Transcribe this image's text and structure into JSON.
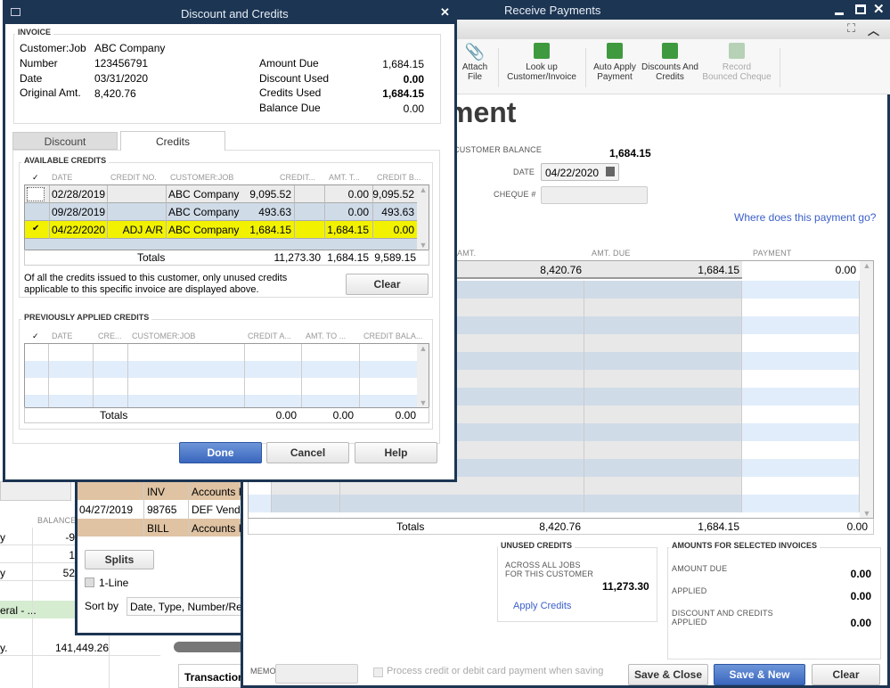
{
  "background": {
    "left_window": {
      "balance_header": "BALANCE",
      "rows": [
        {
          "a": "y",
          "b": "-9"
        },
        {
          "a": "",
          "b": "1"
        },
        {
          "a": "y",
          "b": "52"
        },
        {
          "a": "eral - ...",
          "b": ""
        },
        {
          "a": "y.",
          "b": "141,449.26"
        }
      ],
      "tab_transactions": "Transactions"
    },
    "middle_window": {
      "rows": [
        {
          "date": "",
          "num": "INV",
          "acct": "Accounts F"
        },
        {
          "date": "04/27/2019",
          "num": "98765",
          "acct": "DEF Vendo"
        },
        {
          "date": "",
          "num": "BILL",
          "acct": "Accounts F"
        }
      ],
      "splits_label": "Splits",
      "one_line_label": "1-Line",
      "sort_by_label": "Sort by",
      "sort_by_value": "Date, Type, Number/Ref"
    }
  },
  "receive_payments": {
    "title": "Receive Payments",
    "toolbar": [
      {
        "icon": "paperclip-icon",
        "label1": "Attach",
        "label2": "File",
        "enabled": true
      },
      {
        "icon": "lookup-customer-icon",
        "label1": "Look up",
        "label2": "Customer/Invoice",
        "enabled": true
      },
      {
        "icon": "auto-apply-icon",
        "label1": "Auto Apply",
        "label2": "Payment",
        "enabled": true
      },
      {
        "icon": "discounts-credits-icon",
        "label1": "Discounts And",
        "label2": "Credits",
        "enabled": true
      },
      {
        "icon": "bounced-cheque-icon",
        "label1": "Record",
        "label2": "Bounced Cheque",
        "enabled": false
      }
    ],
    "heading_partial": "ment",
    "customer_balance_label": "CUSTOMER BALANCE",
    "customer_balance": "1,684.15",
    "date_label": "DATE",
    "date_value": "04/22/2020",
    "cheque_label": "CHEQUE #",
    "cheque_value": "",
    "where_link": "Where does this payment go?",
    "grid": {
      "headers": [
        "AMT.",
        "AMT. DUE",
        "PAYMENT"
      ],
      "row": {
        "amt": "8,420.76",
        "amt_due": "1,684.15",
        "payment": "0.00"
      },
      "totals_label": "Totals",
      "totals": {
        "amt": "8,420.76",
        "amt_due": "1,684.15",
        "payment": "0.00"
      }
    },
    "unused_credits": {
      "title": "UNUSED CREDITS",
      "line1": "ACROSS ALL JOBS",
      "line2": "FOR THIS CUSTOMER",
      "amount": "11,273.30",
      "apply_link": "Apply Credits"
    },
    "amounts": {
      "title": "AMOUNTS FOR SELECTED INVOICES",
      "amount_due_label": "AMOUNT DUE",
      "amount_due": "0.00",
      "applied_label": "APPLIED",
      "applied": "0.00",
      "disc_label1": "DISCOUNT AND CREDITS",
      "disc_label2": "APPLIED",
      "disc": "0.00"
    },
    "memo_label": "MEMO",
    "process_label": "Process credit or debit card payment when saving",
    "save_close": "Save & Close",
    "save_new": "Save & New",
    "clear": "Clear"
  },
  "dialog": {
    "title": "Discount and Credits",
    "invoice": {
      "title": "INVOICE",
      "customer_label": "Customer:Job",
      "customer": "ABC Company",
      "number_label": "Number",
      "number": "123456791",
      "date_label": "Date",
      "date": "03/31/2020",
      "orig_label": "Original Amt.",
      "orig": "8,420.76",
      "amount_due_label": "Amount Due",
      "amount_due": "1,684.15",
      "discount_used_label": "Discount Used",
      "discount_used": "0.00",
      "credits_used_label": "Credits Used",
      "credits_used": "1,684.15",
      "balance_due_label": "Balance Due",
      "balance_due": "0.00"
    },
    "tabs": [
      {
        "label": "Discount",
        "active": false
      },
      {
        "label": "Credits",
        "active": true
      }
    ],
    "available": {
      "title": "AVAILABLE CREDITS",
      "headers": [
        "✓",
        "DATE",
        "CREDIT NO.",
        "CUSTOMER:JOB",
        "CREDIT...",
        "AMT. T...",
        "CREDIT B..."
      ],
      "rows": [
        {
          "checked": false,
          "date": "02/28/2019",
          "credit_no": "",
          "customer": "ABC Company",
          "credit": "9,095.52",
          "amt": "0.00",
          "balance": "9,095.52"
        },
        {
          "checked": false,
          "date": "09/28/2019",
          "credit_no": "",
          "customer": "ABC Company",
          "credit": "493.63",
          "amt": "0.00",
          "balance": "493.63"
        },
        {
          "checked": true,
          "date": "04/22/2020",
          "credit_no": "ADJ A/R",
          "customer": "ABC Company",
          "credit": "1,684.15",
          "amt": "1,684.15",
          "balance": "0.00"
        }
      ],
      "totals_label": "Totals",
      "totals": {
        "credit": "11,273.30",
        "amt": "1,684.15",
        "balance": "9,589.15"
      },
      "note1": "Of all the credits issued to this customer, only unused credits",
      "note2": "applicable to this specific invoice are displayed above.",
      "clear": "Clear",
      "highlight_color": "#f2f200"
    },
    "previous": {
      "title": "PREVIOUSLY APPLIED CREDITS",
      "headers": [
        "✓",
        "DATE",
        "CRE...",
        "CUSTOMER:JOB",
        "CREDIT A...",
        "AMT. TO ...",
        "CREDIT BALA..."
      ],
      "totals_label": "Totals",
      "totals": {
        "credit": "0.00",
        "amt": "0.00",
        "balance": "0.00"
      }
    },
    "done": "Done",
    "cancel": "Cancel",
    "help": "Help"
  }
}
